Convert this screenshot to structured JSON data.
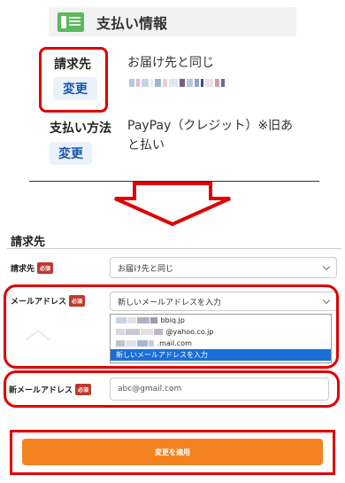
{
  "payment_section": {
    "title": "支払い情報",
    "billing_label": "請求先",
    "billing_change_label": "変更",
    "billing_value": "お届け先と同じ",
    "method_label": "支払い方法",
    "method_change_label": "変更",
    "method_value_line1": "PayPay（クレジット）※旧あ",
    "method_value_line2": "と払い"
  },
  "form": {
    "title": "請求先",
    "billing_field": {
      "label": "請求先",
      "required_badge": "必須",
      "selected": "お届け先と同じ"
    },
    "email_field": {
      "label": "メールアドレス",
      "required_badge": "必須",
      "selected": "新しいメールアドレスを入力",
      "options": [
        {
          "suffix": "bbiq.jp"
        },
        {
          "suffix": "@yahoo.co.jp"
        },
        {
          "suffix": ".mail.com"
        },
        {
          "suffix": "新しいメールアドレスを入力"
        }
      ]
    },
    "new_email_field": {
      "label": "新メールアドレス",
      "required_badge": "必須",
      "placeholder": "abc@gmail.com"
    },
    "apply_button": "変更を適用"
  },
  "colors": {
    "highlight_red": "#e00000",
    "accent_orange": "#f58220",
    "link_blue": "#1a56b0",
    "section_icon_green": "#5cb85c"
  }
}
